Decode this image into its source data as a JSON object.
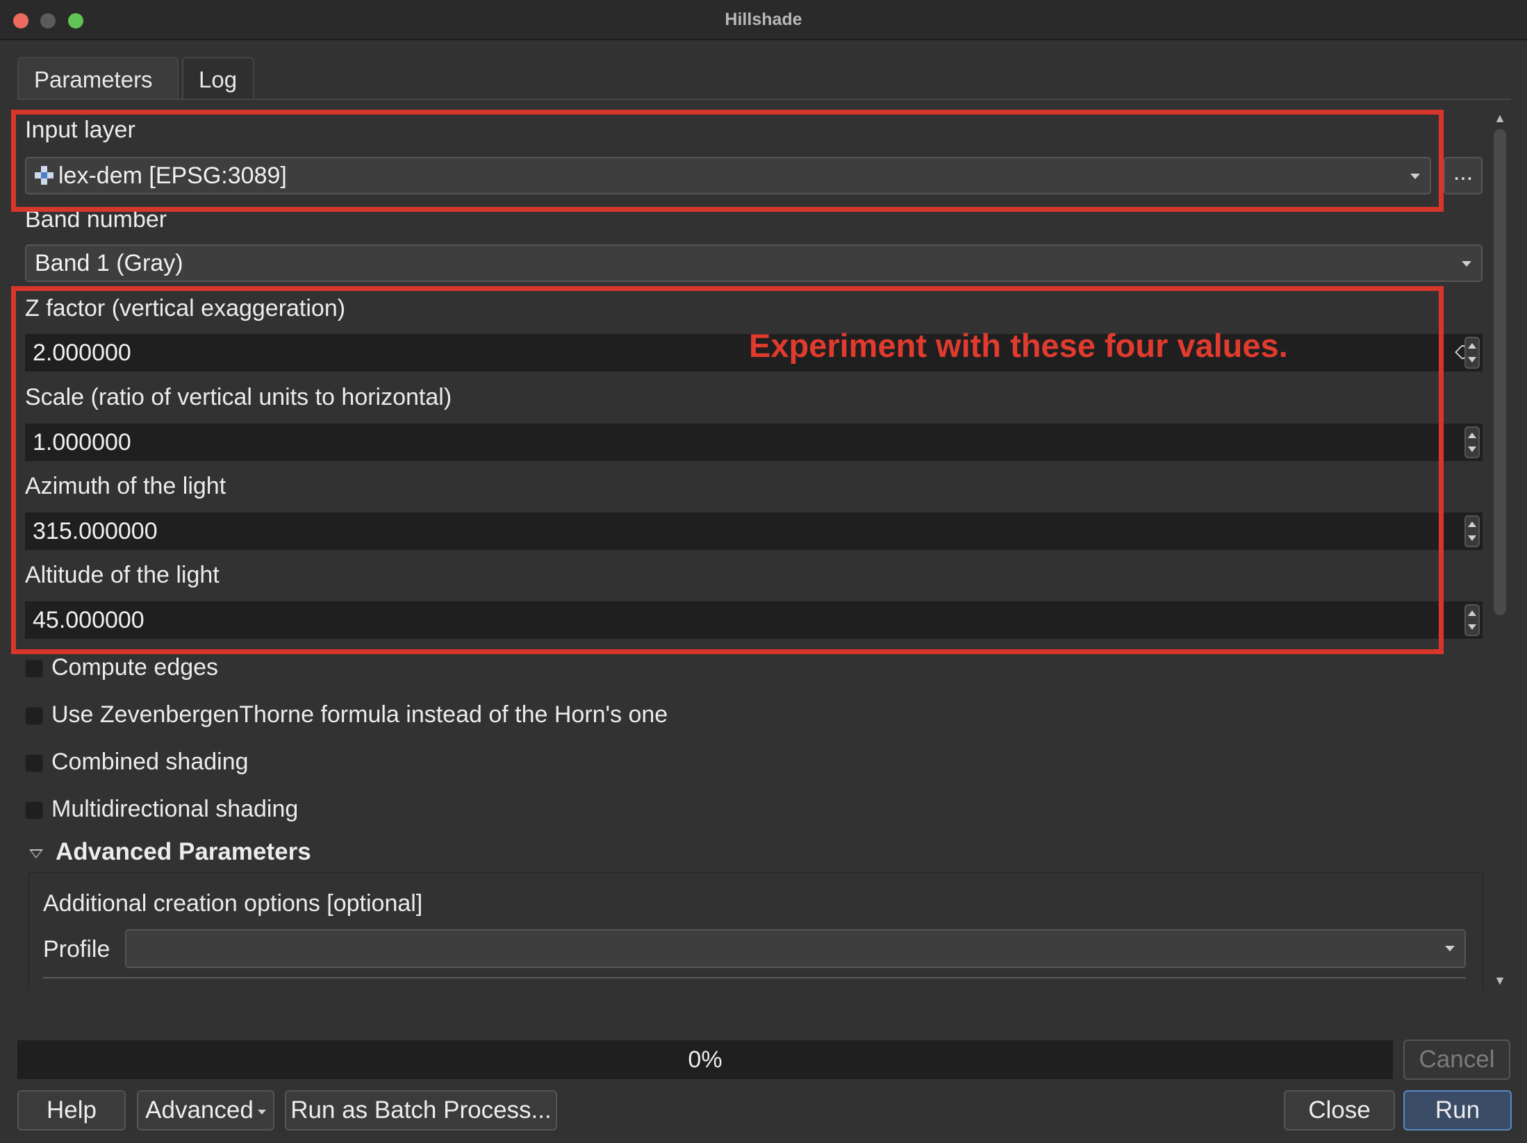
{
  "window": {
    "title": "Hillshade"
  },
  "tabs": [
    {
      "label": "Parameters",
      "active": true
    },
    {
      "label": "Log",
      "active": false
    }
  ],
  "params": {
    "input_layer": {
      "label": "Input layer",
      "value": "lex-dem [EPSG:3089]",
      "browse_label": "..."
    },
    "band": {
      "label": "Band number",
      "value": "Band 1 (Gray)"
    },
    "z_factor": {
      "label": "Z factor (vertical exaggeration)",
      "value": "2.000000"
    },
    "scale": {
      "label": "Scale (ratio of vertical units to horizontal)",
      "value": "1.000000"
    },
    "azimuth": {
      "label": "Azimuth of the light",
      "value": "315.000000"
    },
    "altitude": {
      "label": "Altitude of the light",
      "value": "45.000000"
    },
    "checkboxes": [
      {
        "label": "Compute edges",
        "checked": false
      },
      {
        "label": "Use ZevenbergenThorne formula instead of the Horn's one",
        "checked": false
      },
      {
        "label": "Combined shading",
        "checked": false
      },
      {
        "label": "Multidirectional shading",
        "checked": false
      }
    ]
  },
  "advanced": {
    "header": "Advanced Parameters",
    "creation_options_label": "Additional creation options [optional]",
    "profile_label": "Profile",
    "profile_value": ""
  },
  "annotation": {
    "text": "Experiment with these four values.",
    "color": "#d9362b"
  },
  "progress": {
    "text": "0%",
    "value": 0
  },
  "buttons": {
    "cancel": "Cancel",
    "help": "Help",
    "advanced": "Advanced",
    "batch": "Run as Batch Process...",
    "close": "Close",
    "run": "Run"
  },
  "icons": {
    "close": "close-icon",
    "minimize": "minimize-icon",
    "maximize": "maximize-icon",
    "layer": "raster-layer-icon",
    "dropdown": "chevron-down-icon",
    "clear": "clear-icon"
  }
}
